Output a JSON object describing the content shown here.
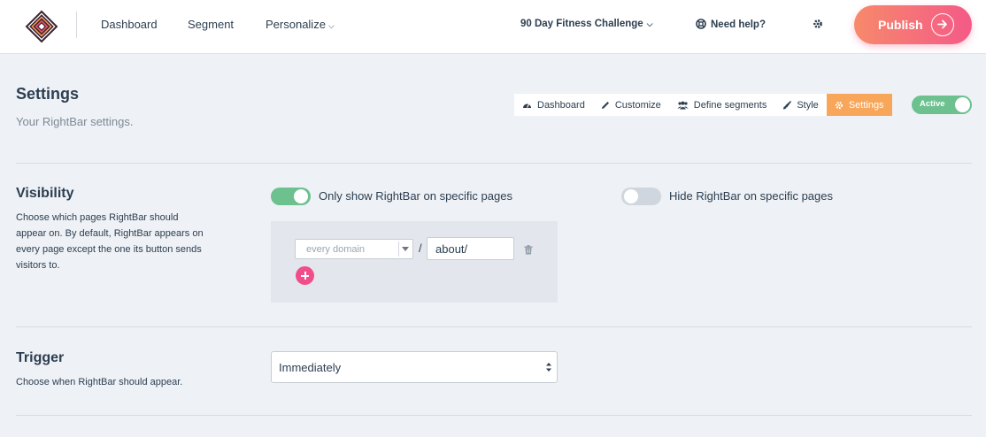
{
  "nav": {
    "links": [
      "Dashboard",
      "Segment",
      "Personalize"
    ],
    "project": "90 Day Fitness Challenge",
    "help": "Need help?",
    "publish": "Publish"
  },
  "header": {
    "title": "Settings",
    "subtitle": "Your RightBar settings.",
    "tabs": [
      "Dashboard",
      "Customize",
      "Define segments",
      "Style",
      "Settings"
    ],
    "active_tab": "Settings",
    "status_toggle": "Active"
  },
  "visibility": {
    "title": "Visibility",
    "description": "Choose which pages RightBar should appear on. By default, RightBar appears on every page except the one its button sends visitors to.",
    "only_show_label": "Only show RightBar on specific pages",
    "only_show_on": true,
    "hide_label": "Hide RightBar on specific pages",
    "hide_on": false,
    "rule": {
      "domain": "every domain",
      "separator": "/",
      "path": "about/"
    }
  },
  "trigger": {
    "title": "Trigger",
    "description": "Choose when RightBar should appear.",
    "value": "Immediately"
  },
  "colors": {
    "accent_orange": "#f7a65a",
    "toggle_green": "#6cc18f",
    "add_pink": "#f14d8b",
    "publish_gradient_start": "#f7896b",
    "publish_gradient_end": "#f45a87"
  }
}
